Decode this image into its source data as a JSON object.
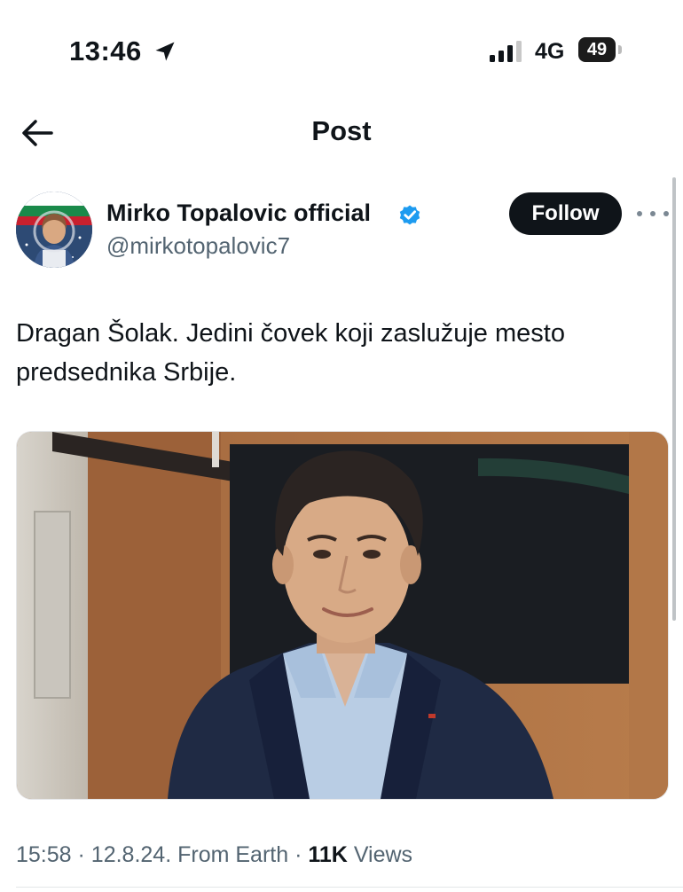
{
  "status_bar": {
    "time": "13:46",
    "network": "4G",
    "battery": "49",
    "icons": [
      "location-arrow-icon",
      "cellular-signal-icon",
      "battery-icon"
    ]
  },
  "header": {
    "title": "Post",
    "back_icon": "arrow-left-icon"
  },
  "author": {
    "display_name": "Mirko Topalovic official",
    "handle": "@mirkotopalovic7",
    "verified_icon": "verified-badge-icon",
    "follow_label": "Follow",
    "more_icon": "more-dots-icon"
  },
  "post": {
    "text": "Dragan Šolak. Jedini čovek koji zaslužuje mesto predsednika Srbije.",
    "meta": {
      "time": "15:58",
      "date": "12.8.24.",
      "source": "From Earth",
      "views_count": "11K",
      "views_label": "Views",
      "separator": "·"
    }
  },
  "colors": {
    "text_primary": "#0f1419",
    "text_secondary": "#536471",
    "verified_blue": "#1d9bf0",
    "follow_bg": "#0f1419"
  }
}
